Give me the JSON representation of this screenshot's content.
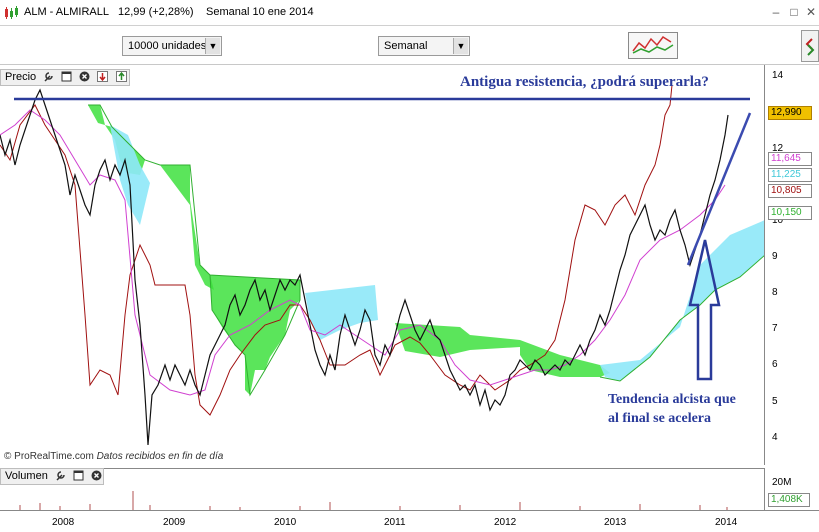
{
  "window": {
    "symbol": "ALM - ALMIRALL",
    "price_change": "12,99 (+2,28%)",
    "period_date": "Semanal  10 ene 2014"
  },
  "toolbar": {
    "quantity_select": "10000 unidades",
    "timeframe_select": "Semanal"
  },
  "price_panel": {
    "label": "Precio",
    "y_ticks": [
      "14",
      "12",
      "10",
      "9",
      "8",
      "7",
      "6",
      "5",
      "4"
    ],
    "value_labels": [
      {
        "text": "12,990",
        "color": "#f0c000",
        "border": "#b08000"
      },
      {
        "text": "11,645",
        "color": "#d040d0",
        "border": "#888888"
      },
      {
        "text": "11,225",
        "color": "#40d0e0",
        "border": "#888888"
      },
      {
        "text": "10,805",
        "color": "#a01010",
        "border": "#888888"
      },
      {
        "text": "10,150",
        "color": "#30b030",
        "border": "#888888"
      }
    ],
    "annotation_top": "Antigua resistencia, ¿podrá superarla?",
    "annotation_bottom_line1": "Tendencia alcista que",
    "annotation_bottom_line2": "al final se acelera"
  },
  "credit": {
    "source": "© ProRealTime.com",
    "note": "Datos recibidos en fin de día"
  },
  "volume_panel": {
    "label": "Volumen",
    "y_tick": "20M",
    "value_label": "1,408K"
  },
  "x_axis": {
    "labels": [
      "2008",
      "2009",
      "2010",
      "2011",
      "2012",
      "2013",
      "2014"
    ]
  },
  "colors": {
    "annotation": "#2a3b9a",
    "cloud_green": "#3ee03e",
    "cloud_cyan": "#8ee8f8",
    "kijun": "#a01010",
    "tenkan": "#d040d0"
  }
}
